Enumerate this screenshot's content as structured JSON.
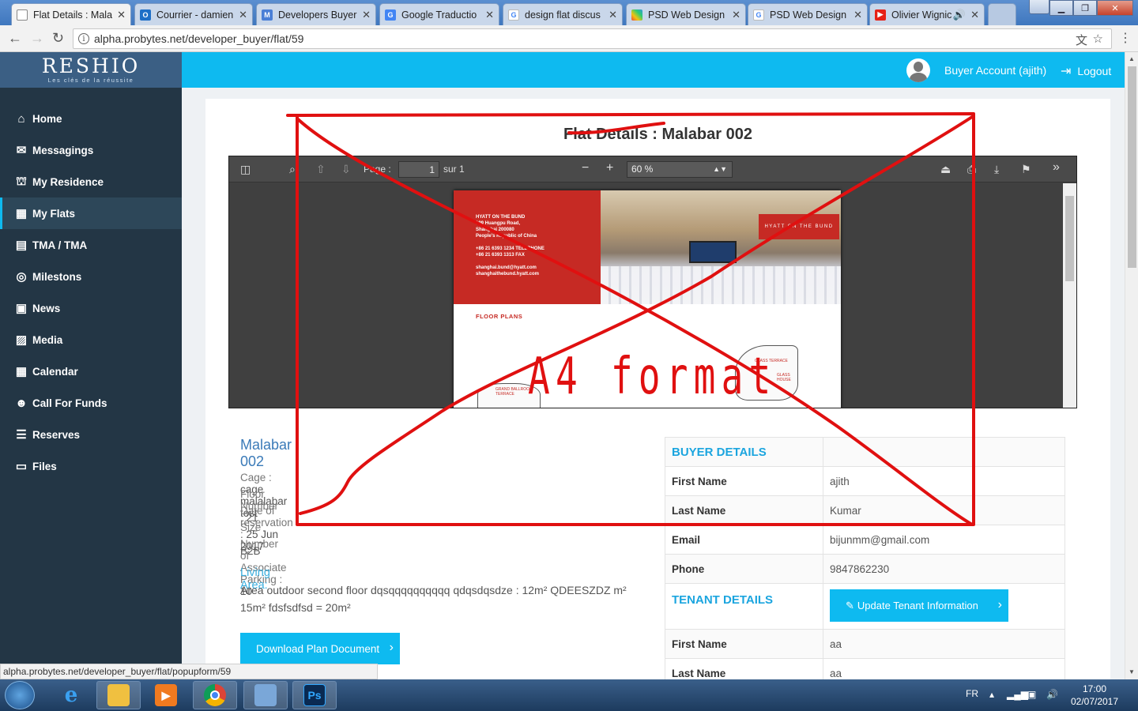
{
  "browser": {
    "tabs": [
      {
        "label": "Flat Details : Mala",
        "icon": "page-icon",
        "color": "#ffffff",
        "active": true
      },
      {
        "label": "Courrier - damien",
        "icon": "outlook-icon",
        "color": "#1e6fc7"
      },
      {
        "label": "Developers Buyer",
        "icon": "mosaic-icon",
        "color": "#4a7fd6"
      },
      {
        "label": "Google Traductio",
        "icon": "translate-icon",
        "color": "#4285f4"
      },
      {
        "label": "design flat discus",
        "icon": "google-icon",
        "color": "#ffffff"
      },
      {
        "label": "PSD Web Design",
        "icon": "colorful-icon",
        "color": "#e84c3d"
      },
      {
        "label": "PSD Web Design",
        "icon": "google-icon",
        "color": "#ffffff"
      },
      {
        "label": "Olivier Wignic",
        "icon": "youtube-icon",
        "color": "#e62117"
      }
    ],
    "tab_close": "✕",
    "url": "alpha.probytes.net/developer_buyer/flat/59",
    "status_url": "alpha.probytes.net/developer_buyer/flat/popupform/59"
  },
  "app": {
    "logo": "RESHIO",
    "logo_tagline": "Les clés de la réussite",
    "account_name": "Buyer Account (ajith)",
    "logout_label": "Logout",
    "brand_color": "#0ebaf0"
  },
  "sidebar": {
    "items": [
      {
        "label": "Home",
        "icon": "home-icon"
      },
      {
        "label": "Messagings",
        "icon": "envelope-icon"
      },
      {
        "label": "My Residence",
        "icon": "bank-icon"
      },
      {
        "label": "My Flats",
        "icon": "grid-icon",
        "active": true
      },
      {
        "label": "TMA / TMA",
        "icon": "building-icon"
      },
      {
        "label": "Milestons",
        "icon": "target-icon"
      },
      {
        "label": "News",
        "icon": "newspaper-icon"
      },
      {
        "label": "Media",
        "icon": "image-icon"
      },
      {
        "label": "Calendar",
        "icon": "calendar-icon"
      },
      {
        "label": "Call For Funds",
        "icon": "people-icon"
      },
      {
        "label": "Reserves",
        "icon": "list-icon"
      },
      {
        "label": "Files",
        "icon": "folder-icon"
      }
    ]
  },
  "page": {
    "title": "Flat Details : Malabar 002"
  },
  "pdf": {
    "page_label": "Page :",
    "page_value": "1",
    "page_total": "sur 1",
    "zoom": "60 %",
    "document": {
      "hotel_name": "HYATT ON THE BUND",
      "address_lines": [
        "199 Huangpu Road,",
        "Shanghai 200080",
        "People's Republic of China"
      ],
      "phone_lines": [
        "+86 21 6393 1234  TELEPHONE",
        "+86 21 6393 1313  FAX"
      ],
      "web_lines": [
        "shanghai.bund@hyatt.com",
        "shanghaithebund.hyatt.com"
      ],
      "badge": "HYATT ON THE BUND",
      "section_title": "FLOOR PLANS",
      "room_labels": [
        "GRAND BALLROOM TERRACE",
        "GLASS TERRACE",
        "GLASS HOUSE"
      ]
    }
  },
  "flat": {
    "name": "Malabar 002",
    "fields": [
      {
        "label": "Cage : ",
        "value": "cage malalabar test"
      },
      {
        "label": "Floor Number : ",
        "value": "21"
      },
      {
        "label": "Date of reservation : ",
        "value": "25 Jun 2017"
      },
      {
        "label": "Size : ",
        "value": "B2B"
      },
      {
        "label": "Number of Associate Parking : ",
        "value": "10"
      }
    ],
    "living_area_title": "Living Area:",
    "living_area_lines": [
      "Area outdoor second floor dqsqqqqqqqqqq qdqsdqsdze : 12m² QDEESZDZ m²",
      "15m² fdsfsdfsd = 20m²"
    ],
    "download_label": "Download Plan Document"
  },
  "buyer": {
    "heading": "BUYER DETAILS",
    "rows": [
      {
        "label": "First Name",
        "value": "ajith"
      },
      {
        "label": "Last Name",
        "value": "Kumar"
      },
      {
        "label": "Email",
        "value": "bijunmm@gmail.com"
      },
      {
        "label": "Phone",
        "value": "9847862230"
      }
    ]
  },
  "tenant": {
    "heading": "TENANT DETAILS",
    "update_label": "Update Tenant Information",
    "rows": [
      {
        "label": "First Name",
        "value": "aa"
      },
      {
        "label": "Last Name",
        "value": "aa"
      }
    ]
  },
  "annotation": {
    "text": "A4 format",
    "color": "#e01010"
  },
  "taskbar": {
    "language": "FR",
    "time": "17:00",
    "date": "02/07/2017"
  }
}
